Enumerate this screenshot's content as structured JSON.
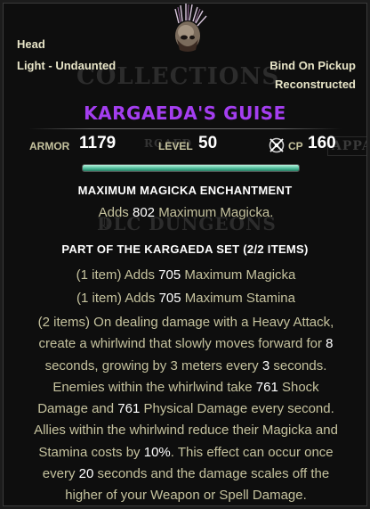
{
  "tooltip": {
    "slot": "Head",
    "weight": "Light - Undaunted",
    "bind": "Bind On Pickup",
    "status": "Reconstructed",
    "name": "KARGAEDA'S GUISE",
    "name_color": "#a43ef0",
    "stats": {
      "armor_label": "ARMOR",
      "armor_value": "1179",
      "level_label": "LEVEL",
      "level_value": "50",
      "cp_label": "CP",
      "cp_value": "160"
    },
    "condition_bar": {
      "fraction": 1.0,
      "color": "#48b896"
    },
    "enchantment": {
      "title": "MAXIMUM MAGICKA ENCHANTMENT",
      "text_a": "Adds",
      "value": "802",
      "text_b": "Maximum Magicka."
    },
    "set": {
      "title": "PART OF THE KARGAEDA SET (2/2 ITEMS)",
      "bonus1": {
        "prefix": "(1 item) Adds",
        "value": "705",
        "suffix": "Maximum Magicka"
      },
      "bonus2": {
        "prefix": "(1 item) Adds",
        "value": "705",
        "suffix": "Maximum Stamina"
      },
      "bonus3_rows": [
        {
          "a": "(2 items) On dealing damage with a Heavy Attack,",
          "v": "",
          "b": ""
        },
        {
          "a": "create a whirlwind that slowly moves forward for",
          "v": "8",
          "b": ""
        },
        {
          "a": "seconds, growing by 3 meters every",
          "v": "3",
          "b": "seconds."
        },
        {
          "a": "Enemies within the whirlwind take",
          "v": "761",
          "b": "Shock"
        },
        {
          "a": "Damage and",
          "v": "761",
          "b": "Physical Damage every second."
        },
        {
          "a": "Allies within the whirlwind reduce their Magicka and",
          "v": "",
          "b": ""
        },
        {
          "a": "Stamina costs by",
          "v": "10%",
          "b": ". This effect can occur once"
        },
        {
          "a": "every",
          "v": "20",
          "b": "seconds and the damage scales off the"
        },
        {
          "a": "higher of your Weapon or Spell Damage.",
          "v": "",
          "b": ""
        }
      ]
    },
    "icons": {
      "item": "feathered-helm-icon",
      "cp": "champion-point-icon"
    }
  },
  "background": {
    "collections": "COLLECTIONS",
    "dlc": "DLC DUNGEONS",
    "argaed": "rgaed",
    "appa": "Appa"
  }
}
